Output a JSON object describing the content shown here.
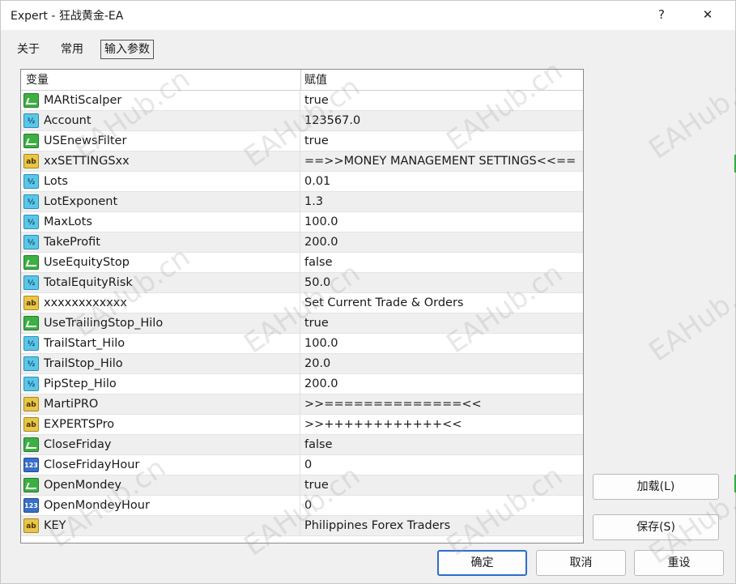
{
  "window": {
    "title": "Expert - 狂战黄金-EA",
    "help_label": "?",
    "close_label": "✕"
  },
  "tabs": [
    {
      "label": "关于",
      "active": false
    },
    {
      "label": "常用",
      "active": false
    },
    {
      "label": "输入参数",
      "active": true
    }
  ],
  "grid": {
    "header_name": "变量",
    "header_value": "赋值",
    "rows": [
      {
        "icon": "bool-icon",
        "type": "bool",
        "name": "MARtiScalper",
        "value": "true"
      },
      {
        "icon": "double-icon",
        "type": "dbl",
        "name": "Account",
        "value": "123567.0"
      },
      {
        "icon": "bool-icon",
        "type": "bool",
        "name": "USEnewsFilter",
        "value": "true"
      },
      {
        "icon": "string-icon",
        "type": "str",
        "name": "xxSETTINGSxx",
        "value": "==>>MONEY MANAGEMENT SETTINGS<<=="
      },
      {
        "icon": "double-icon",
        "type": "dbl",
        "name": "Lots",
        "value": "0.01"
      },
      {
        "icon": "double-icon",
        "type": "dbl",
        "name": "LotExponent",
        "value": "1.3"
      },
      {
        "icon": "double-icon",
        "type": "dbl",
        "name": "MaxLots",
        "value": "100.0"
      },
      {
        "icon": "double-icon",
        "type": "dbl",
        "name": "TakeProfit",
        "value": "200.0"
      },
      {
        "icon": "bool-icon",
        "type": "bool",
        "name": "UseEquityStop",
        "value": "false"
      },
      {
        "icon": "double-icon",
        "type": "dbl",
        "name": "TotalEquityRisk",
        "value": "50.0"
      },
      {
        "icon": "string-icon",
        "type": "str",
        "name": "xxxxxxxxxxxx",
        "value": "Set Current Trade & Orders"
      },
      {
        "icon": "bool-icon",
        "type": "bool",
        "name": "UseTrailingStop_Hilo",
        "value": "true"
      },
      {
        "icon": "double-icon",
        "type": "dbl",
        "name": "TrailStart_Hilo",
        "value": "100.0"
      },
      {
        "icon": "double-icon",
        "type": "dbl",
        "name": "TrailStop_Hilo",
        "value": "20.0"
      },
      {
        "icon": "double-icon",
        "type": "dbl",
        "name": "PipStep_Hilo",
        "value": "200.0"
      },
      {
        "icon": "string-icon",
        "type": "str",
        "name": "MartiPRO",
        "value": ">>==============<<"
      },
      {
        "icon": "string-icon",
        "type": "str",
        "name": "EXPERTSPro",
        "value": ">>++++++++++++<<"
      },
      {
        "icon": "bool-icon",
        "type": "bool",
        "name": "CloseFriday",
        "value": "false"
      },
      {
        "icon": "int-icon",
        "type": "int",
        "name": "CloseFridayHour",
        "value": "0"
      },
      {
        "icon": "bool-icon",
        "type": "bool",
        "name": "OpenMondey",
        "value": "true"
      },
      {
        "icon": "int-icon",
        "type": "int",
        "name": "OpenMondeyHour",
        "value": "0"
      },
      {
        "icon": "string-icon",
        "type": "str",
        "name": "KEY",
        "value": "Philippines Forex Traders"
      }
    ]
  },
  "icon_glyphs": {
    "dbl": "½",
    "str": "ab",
    "int": "123",
    "bool": ""
  },
  "buttons": {
    "load": "加载(L)",
    "save": "保存(S)",
    "ok": "确定",
    "cancel": "取消",
    "reset": "重设"
  },
  "watermark_text": "EAHub.cn",
  "colors": {
    "accent": "#2d6ec8",
    "bool_icon": "#3cb043",
    "double_icon": "#5cc6e8",
    "string_icon": "#e8c64a",
    "int_icon": "#3a6fc4"
  }
}
